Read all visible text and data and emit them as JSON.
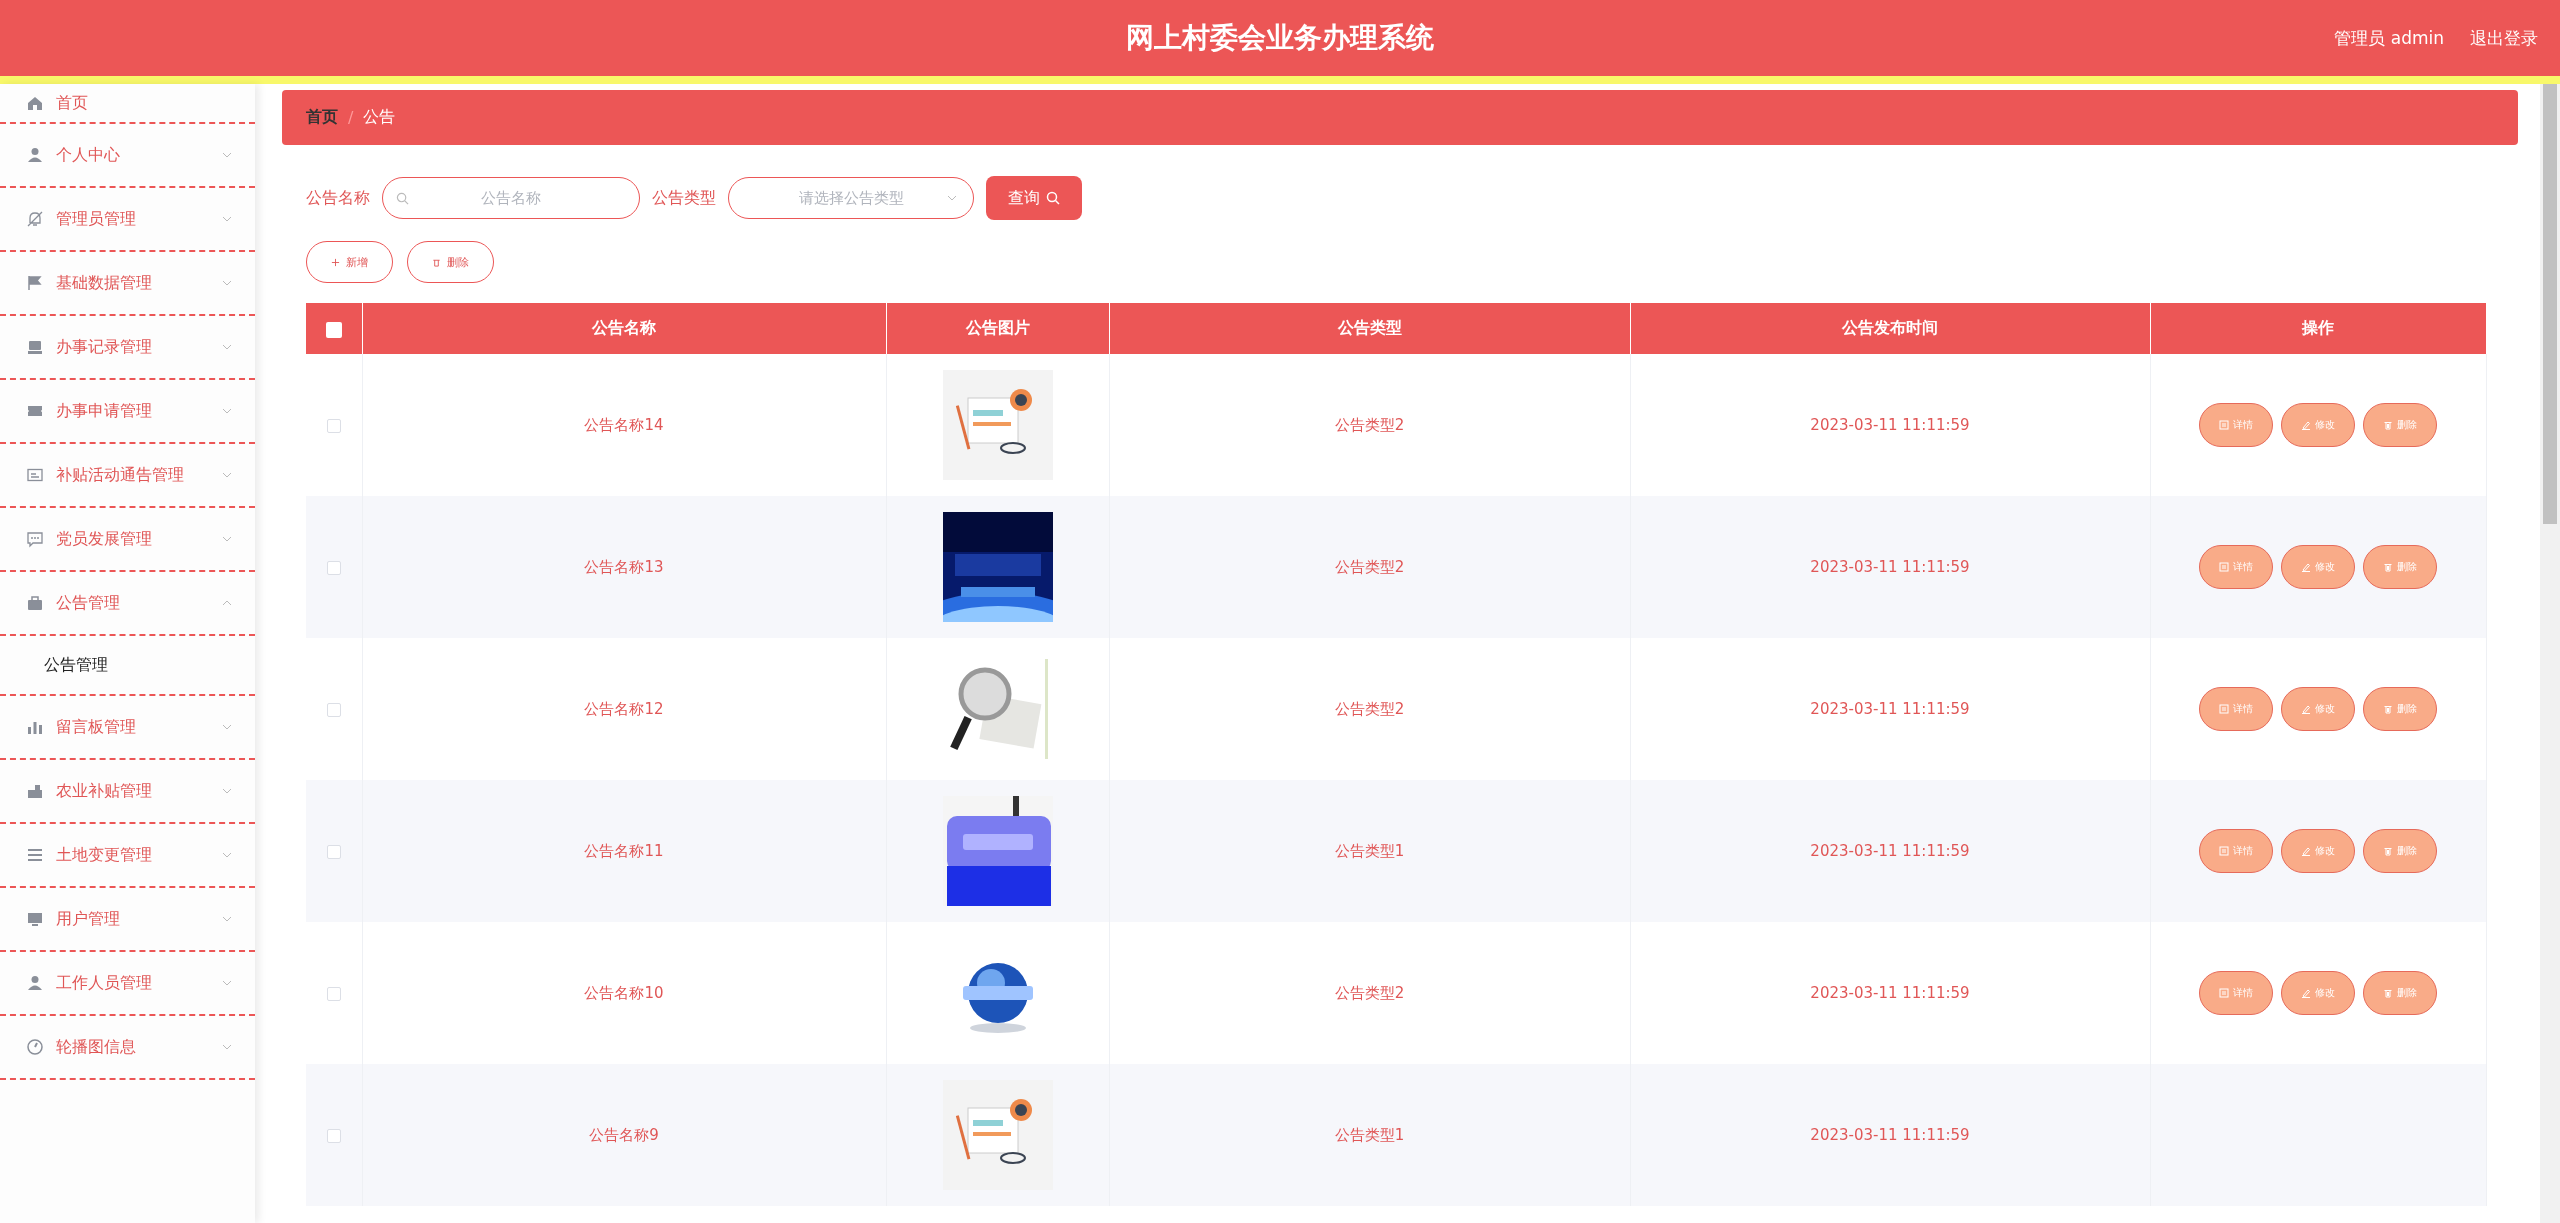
{
  "header": {
    "title": "网上村委会业务办理系统",
    "user": "管理员 admin",
    "logout": "退出登录"
  },
  "sidebar": {
    "items": [
      {
        "label": "首页",
        "kind": "link"
      },
      {
        "label": "个人中心",
        "kind": "menu",
        "expanded": false
      },
      {
        "label": "管理员管理",
        "kind": "menu",
        "expanded": false
      },
      {
        "label": "基础数据管理",
        "kind": "menu",
        "expanded": false
      },
      {
        "label": "办事记录管理",
        "kind": "menu",
        "expanded": false
      },
      {
        "label": "办事申请管理",
        "kind": "menu",
        "expanded": false
      },
      {
        "label": "补贴活动通告管理",
        "kind": "menu",
        "expanded": false
      },
      {
        "label": "党员发展管理",
        "kind": "menu",
        "expanded": false
      },
      {
        "label": "公告管理",
        "kind": "menu",
        "expanded": true,
        "children": [
          {
            "label": "公告管理",
            "selected": true
          }
        ]
      },
      {
        "label": "留言板管理",
        "kind": "menu",
        "expanded": false
      },
      {
        "label": "农业补贴管理",
        "kind": "menu",
        "expanded": false
      },
      {
        "label": "土地变更管理",
        "kind": "menu",
        "expanded": false
      },
      {
        "label": "用户管理",
        "kind": "menu",
        "expanded": false
      },
      {
        "label": "工作人员管理",
        "kind": "menu",
        "expanded": false
      },
      {
        "label": "轮播图信息",
        "kind": "menu",
        "expanded": false
      }
    ]
  },
  "breadcrumb": {
    "items": [
      "首页",
      "公告"
    ],
    "separator": "/"
  },
  "search": {
    "name_label": "公告名称",
    "name_placeholder": "公告名称",
    "type_label": "公告类型",
    "type_placeholder": "请选择公告类型",
    "query_button": "查询"
  },
  "toolbar": [
    "新增",
    "删除"
  ],
  "table": {
    "header_checked": false,
    "columns": [
      "公告名称",
      "公告图片",
      "公告类型",
      "公告发布时间",
      "操作"
    ],
    "rows": [
      {
        "checked": false,
        "name": "公告名称14",
        "type": "公告类型2",
        "time": "2023-03-11 11:11:59",
        "actions": [
          "详情",
          "修改",
          "删除"
        ]
      },
      {
        "checked": false,
        "name": "公告名称13",
        "type": "公告类型2",
        "time": "2023-03-11 11:11:59",
        "actions": [
          "详情",
          "修改",
          "删除"
        ]
      },
      {
        "checked": false,
        "name": "公告名称12",
        "type": "公告类型2",
        "time": "2023-03-11 11:11:59",
        "actions": [
          "详情",
          "修改",
          "删除"
        ]
      },
      {
        "checked": false,
        "name": "公告名称11",
        "type": "公告类型1",
        "time": "2023-03-11 11:11:59",
        "actions": [
          "详情",
          "修改",
          "删除"
        ]
      },
      {
        "checked": false,
        "name": "公告名称10",
        "type": "公告类型2",
        "time": "2023-03-11 11:11:59",
        "actions": [
          "详情",
          "修改",
          "删除"
        ]
      },
      {
        "checked": false,
        "name": "公告名称9",
        "type": "公告类型1",
        "time": "2023-03-11 11:11:59"
      }
    ]
  }
}
